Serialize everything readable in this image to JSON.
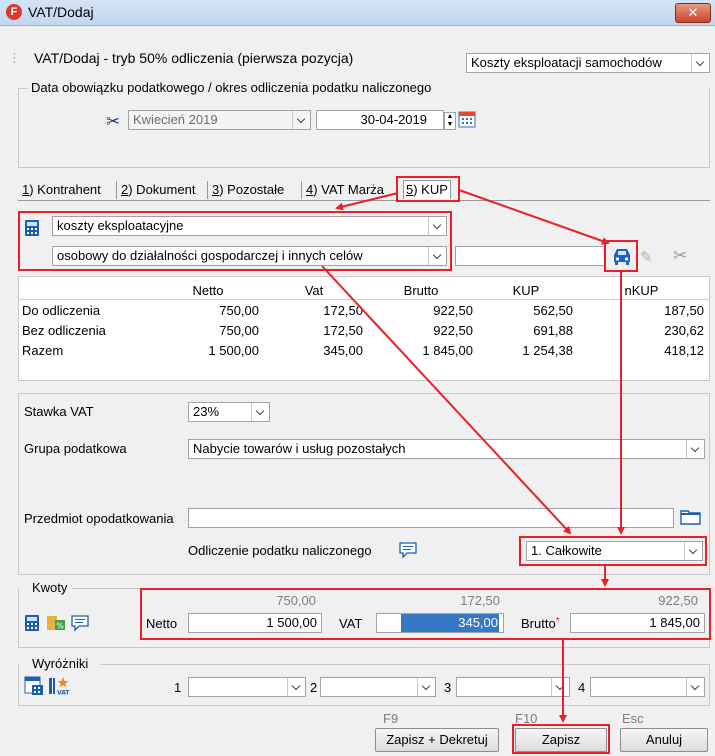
{
  "window": {
    "title": "VAT/Dodaj",
    "app_icon_letter": "F",
    "close_glyph": "✕"
  },
  "header": {
    "mode_title": "VAT/Dodaj - tryb 50% odliczenia (pierwsza pozycja)",
    "category_select": "Koszty eksploatacji samochodów"
  },
  "period": {
    "group_label": "Data obowiązku podatkowego / okres odliczenia podatku naliczonego",
    "month": "Kwiecień 2019",
    "date": "30-04-2019"
  },
  "tabs": [
    {
      "key": "1",
      "label": ") Kontrahent"
    },
    {
      "key": "2",
      "label": ") Dokument"
    },
    {
      "key": "3",
      "label": ") Pozostałe"
    },
    {
      "key": "4",
      "label": ") VAT Marża"
    },
    {
      "key": "5",
      "label": ") KUP"
    }
  ],
  "kup": {
    "cost_type": "koszty eksploatacyjne",
    "vehicle_type": "osobowy do działalności gospodarczej i innych celów",
    "table": {
      "headers": [
        "",
        "Netto",
        "Vat",
        "Brutto",
        "KUP",
        "nKUP"
      ],
      "rows": [
        [
          "Do odliczenia",
          "750,00",
          "172,50",
          "922,50",
          "562,50",
          "187,50"
        ],
        [
          "Bez odliczenia",
          "750,00",
          "172,50",
          "922,50",
          "691,88",
          "230,62"
        ],
        [
          "Razem",
          "1 500,00",
          "345,00",
          "1 845,00",
          "1 254,38",
          "418,12"
        ]
      ]
    }
  },
  "form": {
    "vat_rate_label": "Stawka VAT",
    "vat_rate": "23%",
    "tax_group_label": "Grupa podatkowa",
    "tax_group": "Nabycie towarów i usług pozostałych",
    "subject_label": "Przedmiot opodatkowania",
    "subject_value": "",
    "deduction_label": "Odliczenie podatku naliczonego",
    "deduction_value": "1. Całkowite"
  },
  "amounts": {
    "group_label": "Kwoty",
    "prev_net": "750,00",
    "prev_vat": "172,50",
    "prev_gross": "922,50",
    "net_label": "Netto",
    "net": "1 500,00",
    "vat_label": "VAT",
    "vat": "345,00",
    "gross_label": "Brutto",
    "gross_required": "*",
    "gross": "1 845,00"
  },
  "distinguishers": {
    "group_label": "Wyróżniki",
    "n1": "1",
    "n2": "2",
    "n3": "3",
    "n4": "4"
  },
  "buttons": {
    "save_decree": {
      "key": "F9",
      "label": "Zapisz + Dekretuj"
    },
    "save": {
      "key": "F10",
      "label": "Zapisz"
    },
    "cancel": {
      "key": "Esc",
      "label": "Anuluj"
    }
  },
  "colors": {
    "highlight": "#e8202a",
    "selection": "#3778c6",
    "car_icon": "#1b63c6"
  }
}
